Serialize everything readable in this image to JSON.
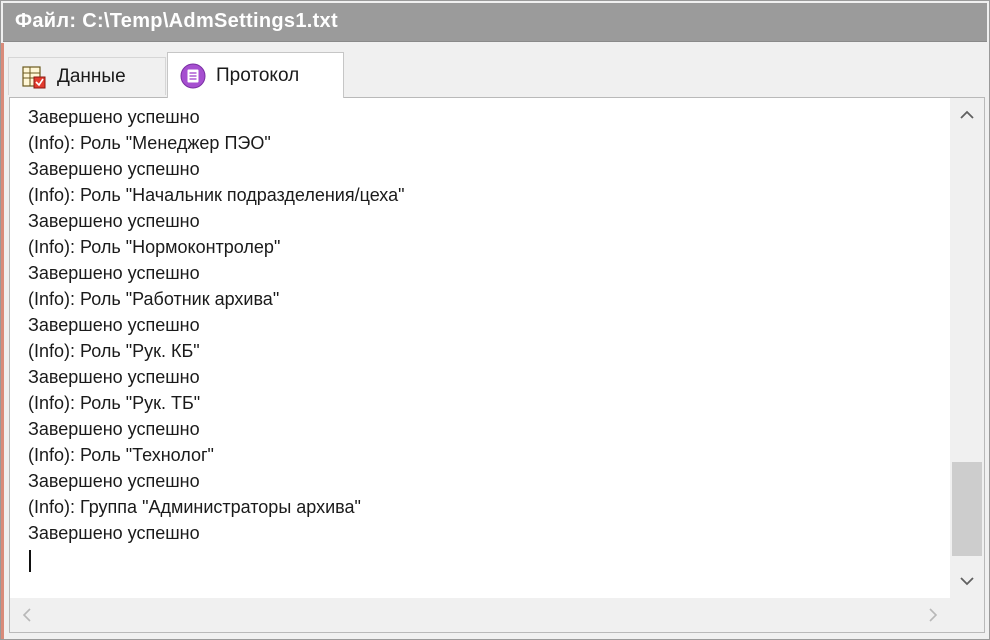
{
  "window": {
    "title": "Файл: C:\\Temp\\AdmSettings1.txt"
  },
  "tabs": [
    {
      "label": "Данные",
      "icon": "data-table-icon",
      "active": false
    },
    {
      "label": "Протокол",
      "icon": "protocol-list-icon",
      "active": true
    }
  ],
  "log": {
    "lines": [
      "Завершено успешно",
      "(Info): Роль \"Менеджер ПЭО\"",
      "Завершено успешно",
      "(Info): Роль \"Начальник подразделения/цеха\"",
      "Завершено успешно",
      "(Info): Роль \"Нормоконтролер\"",
      "Завершено успешно",
      "(Info): Роль \"Работник архива\"",
      "Завершено успешно",
      "(Info): Роль \"Рук. КБ\"",
      "Завершено успешно",
      "(Info): Роль \"Рук. ТБ\"",
      "Завершено успешно",
      "(Info): Роль \"Технолог\"",
      "Завершено успешно",
      "(Info): Группа \"Администраторы архива\"",
      "Завершено успешно"
    ]
  },
  "scrollbars": {
    "vertical_up": "▲",
    "vertical_down": "▼",
    "horizontal_left": "<",
    "horizontal_right": ">"
  },
  "colors": {
    "title_bar": "#9b9b9b",
    "protocol_icon": "#a64fd0",
    "accent_left": "#d98b7a"
  }
}
